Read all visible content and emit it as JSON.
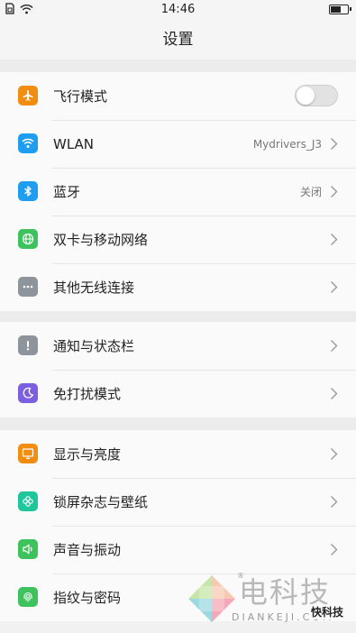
{
  "status_bar": {
    "time": "14:46",
    "left_icons": [
      "sim-icon",
      "wifi-icon"
    ],
    "battery_icon": "battery-icon"
  },
  "header": {
    "title": "设置"
  },
  "groups": [
    {
      "items": [
        {
          "label": "飞行模式",
          "icon": "airplane-icon",
          "icon_color": "#f18e12",
          "control": "toggle",
          "toggle_on": false
        },
        {
          "label": "WLAN",
          "icon": "wifi-icon",
          "icon_color": "#1f9df0",
          "value": "Mydrivers_J3",
          "control": "chevron"
        },
        {
          "label": "蓝牙",
          "icon": "bluetooth-icon",
          "icon_color": "#1f9df0",
          "value": "关闭",
          "control": "chevron"
        },
        {
          "label": "双卡与移动网络",
          "icon": "globe-icon",
          "icon_color": "#3dc25e",
          "control": "chevron"
        },
        {
          "label": "其他无线连接",
          "icon": "more-icon",
          "icon_color": "#8e949b",
          "control": "chevron"
        }
      ]
    },
    {
      "items": [
        {
          "label": "通知与状态栏",
          "icon": "exclamation-icon",
          "icon_color": "#8e949b",
          "control": "chevron"
        },
        {
          "label": "免打扰模式",
          "icon": "moon-icon",
          "icon_color": "#7b5fe0",
          "control": "chevron"
        }
      ]
    },
    {
      "items": [
        {
          "label": "显示与亮度",
          "icon": "display-icon",
          "icon_color": "#f18e12",
          "control": "chevron"
        },
        {
          "label": "锁屏杂志与壁纸",
          "icon": "flower-icon",
          "icon_color": "#1fc69c",
          "control": "chevron"
        },
        {
          "label": "声音与振动",
          "icon": "speaker-icon",
          "icon_color": "#3dc25e",
          "control": "chevron"
        },
        {
          "label": "指纹与密码",
          "icon": "fingerprint-icon",
          "icon_color": "#3dc25e",
          "control": "chevron"
        }
      ]
    }
  ],
  "watermark": {
    "text": "电科技",
    "subtext": "DIANKEJI.COM",
    "brand": "快科技",
    "registered": "®"
  }
}
